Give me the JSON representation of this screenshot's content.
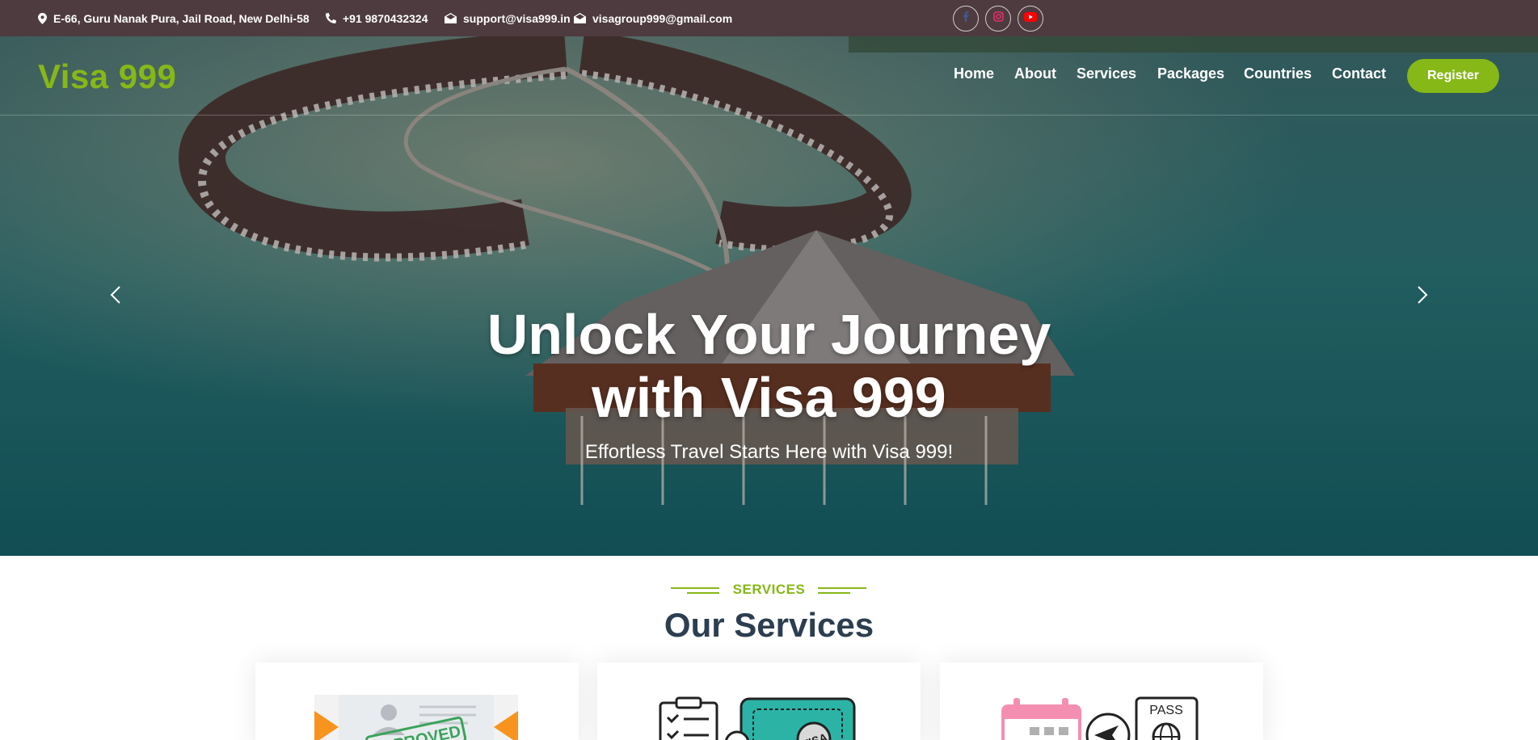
{
  "topbar": {
    "address": "E-66, Guru Nanak Pura, Jail Road, New Delhi-58",
    "phone": "+91 9870432324",
    "email1": "support@visa999.in",
    "email2": "visagroup999@gmail.com",
    "social": [
      {
        "name": "facebook-icon",
        "color": "#3b5998"
      },
      {
        "name": "instagram-icon",
        "color": "#e1306c"
      },
      {
        "name": "youtube-icon",
        "color": "#ff0000"
      }
    ]
  },
  "navbar": {
    "logo": "Visa 999",
    "items": [
      "Home",
      "About",
      "Services",
      "Packages",
      "Countries",
      "Contact"
    ],
    "register": "Register"
  },
  "hero": {
    "title_line1": "Unlock Your Journey",
    "title_line2": "with Visa 999",
    "subtitle": "Effortless Travel Starts Here with Visa 999!"
  },
  "services": {
    "label": "SERVICES",
    "title": "Our Services",
    "card_stamp": "APPROVED",
    "card2_stamp": "VISA",
    "card3_doc": "PASS"
  },
  "colors": {
    "accent": "#86b817",
    "topbar": "#4e3b3f",
    "heading": "#2c3e50"
  }
}
